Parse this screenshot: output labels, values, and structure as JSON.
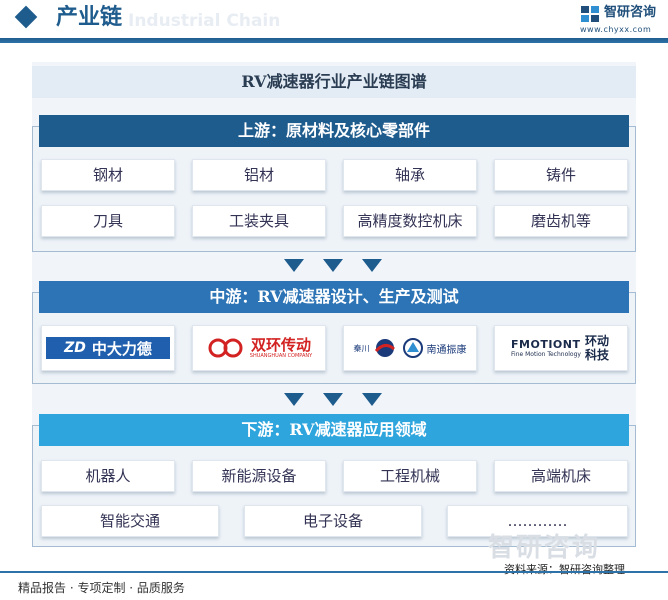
{
  "header": {
    "title": "产业链",
    "ghost_text": "Industrial Chain",
    "brand_name": "智研咨询",
    "brand_url": "www.chyxx.com"
  },
  "main_title": "RV减速器行业产业链图谱",
  "upstream": {
    "title": "上游：原材料及核心零部件",
    "items": [
      "钢材",
      "铝材",
      "轴承",
      "铸件",
      "刀具",
      "工装夹具",
      "高精度数控机床",
      "磨齿机等"
    ]
  },
  "midstream": {
    "title": "中游：RV减速器设计、生产及测试",
    "logos": [
      {
        "mark": "ZD",
        "name": "中大力德"
      },
      {
        "name": "双环传动",
        "sub": "SHUANGHUAN COMPANY"
      },
      {
        "left": "秦川",
        "right": "南通振康"
      },
      {
        "name": "FMOTIONT",
        "cn": "环动科技",
        "sub": "Fine Motion Technology"
      }
    ]
  },
  "downstream": {
    "title": "下游：RV减速器应用领域",
    "items_row1": [
      "机器人",
      "新能源设备",
      "工程机械",
      "高端机床"
    ],
    "items_row2": [
      "智能交通",
      "电子设备",
      "…………"
    ]
  },
  "footer": {
    "left": "精品报告 · 专项定制 · 品质服务",
    "source": "资料来源：智研咨询整理",
    "watermark": "智研咨询"
  },
  "colors": {
    "upstream_head": "#1f5c8e",
    "midstream_head": "#2c74b5",
    "downstream_head": "#2fa5dd",
    "arrow": "#1f5c8e"
  }
}
